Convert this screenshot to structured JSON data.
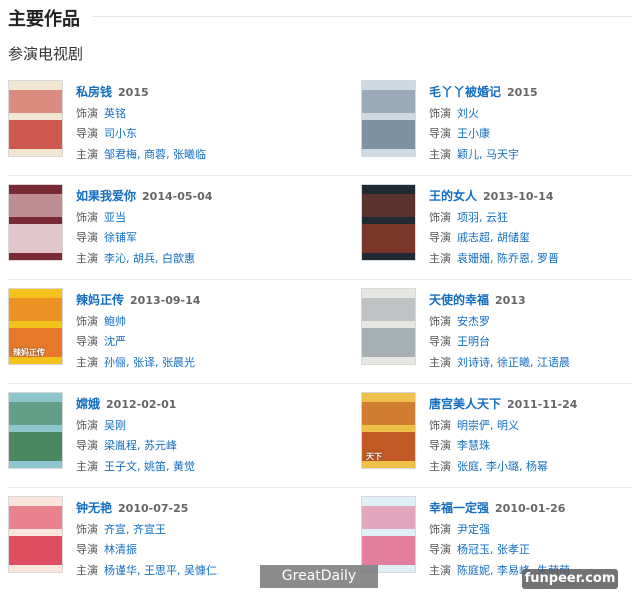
{
  "section_title": "主要作品",
  "subsection_title": "参演电视剧",
  "labels": {
    "role": "饰演",
    "director": "导演",
    "cast": "主演"
  },
  "works": [
    {
      "title": "私房钱",
      "date": "2015",
      "role": "英铭",
      "director": "司小东",
      "cast": "邹君梅, 商蓉, 张曦临",
      "poster_colors": [
        "#f1e6d2",
        "#c9403a"
      ],
      "poster_caption": ""
    },
    {
      "title": "毛丫丫被婚记",
      "date": "2015",
      "role": "刘火",
      "director": "王小康",
      "cast": "颖儿, 马天宇",
      "poster_colors": [
        "#cfd9e2",
        "#6f8496"
      ],
      "poster_caption": ""
    },
    {
      "title": "如果我爱你",
      "date": "2014-05-04",
      "role": "亚当",
      "director": "徐铺军",
      "cast": "李沁, 胡兵, 白歆惠",
      "poster_colors": [
        "#7a2a34",
        "#f4e2e6"
      ],
      "poster_caption": ""
    },
    {
      "title": "王的女人",
      "date": "2013-10-14",
      "role": "项羽, 云狂",
      "director": "戚志超, 胡储玺",
      "cast": "袁姗姗, 陈乔恩, 罗晋",
      "poster_colors": [
        "#1f2a33",
        "#8a3a2a"
      ],
      "poster_caption": ""
    },
    {
      "title": "辣妈正传",
      "date": "2013-09-14",
      "role": "鲍帅",
      "director": "沈严",
      "cast": "孙俪, 张译, 张晨光",
      "poster_colors": [
        "#f3c21c",
        "#e36c2b"
      ],
      "poster_caption": "辣妈正传"
    },
    {
      "title": "天使的幸福",
      "date": "2013",
      "role": "安杰罗",
      "director": "王明台",
      "cast": "刘诗诗, 徐正曦, 江语晨",
      "poster_colors": [
        "#e8e6e2",
        "#9aa4a8"
      ],
      "poster_caption": ""
    },
    {
      "title": "嫦娥",
      "date": "2012-02-01",
      "role": "吴刚",
      "director": "梁胤程, 苏元峰",
      "cast": "王子文, 姚笛, 黄觉",
      "poster_colors": [
        "#8ec6cf",
        "#3f7d4f"
      ],
      "poster_caption": ""
    },
    {
      "title": "唐宫美人天下",
      "date": "2011-11-24",
      "role": "明崇俨, 明义",
      "director": "李慧珠",
      "cast": "张庭, 李小璐, 杨幂",
      "poster_colors": [
        "#f0c14a",
        "#b8461f"
      ],
      "poster_caption": "天下"
    },
    {
      "title": "钟无艳",
      "date": "2010-07-25",
      "role": "齐宣, 齐宣王",
      "director": "林清振",
      "cast": "杨谨华, 王思平, 吴慷仁",
      "poster_colors": [
        "#fbe4dc",
        "#d9324a"
      ],
      "poster_caption": ""
    },
    {
      "title": "幸福一定强",
      "date": "2010-01-26",
      "role": "尹定强",
      "director": "杨冠玉, 张孝正",
      "cast": "陈庭妮, 李易峰, 朱萌萌",
      "poster_colors": [
        "#dff0f6",
        "#e46a8e"
      ],
      "poster_caption": ""
    }
  ],
  "watermarks": {
    "left": "GreatDaily",
    "right": "funpeer.com"
  }
}
